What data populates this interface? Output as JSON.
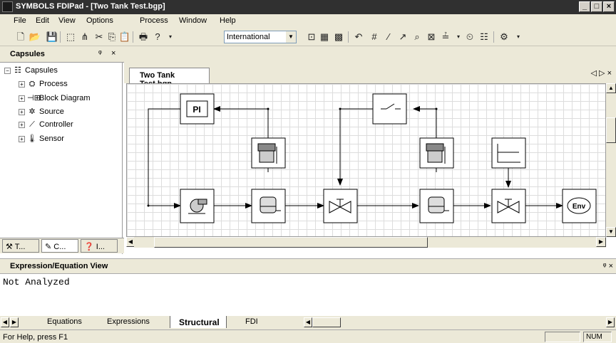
{
  "window": {
    "title": "SYMBOLS FDIPad - [Two Tank Test.bgp]",
    "min": "_",
    "max": "□",
    "close": "×"
  },
  "menu": [
    "File",
    "Edit",
    "View",
    "Options",
    "Process",
    "Window",
    "Help"
  ],
  "toolbar": {
    "combo_value": "International"
  },
  "capsules": {
    "header": "Capsules",
    "pin": "ᵠ",
    "close": "×",
    "root": "Capsules",
    "items": [
      "Process",
      "Block Diagram",
      "Source",
      "Controller",
      "Sensor"
    ],
    "tabs": [
      "T...",
      "C...",
      "I..."
    ]
  },
  "document": {
    "tab": "Two Tank Test.bgp",
    "nav": "◁ ▷ ×",
    "blocks": {
      "pi": "PI",
      "env": "Env"
    }
  },
  "expression_view": {
    "header": "Expression/Equation View",
    "pin_close": "ᵠ ×",
    "content": "Not Analyzed",
    "tabs": [
      "Equations",
      "Expressions",
      "Structural",
      "FDI"
    ],
    "active_tab": "Structural"
  },
  "status": {
    "text": "For Help, press F1",
    "num": "NUM"
  }
}
